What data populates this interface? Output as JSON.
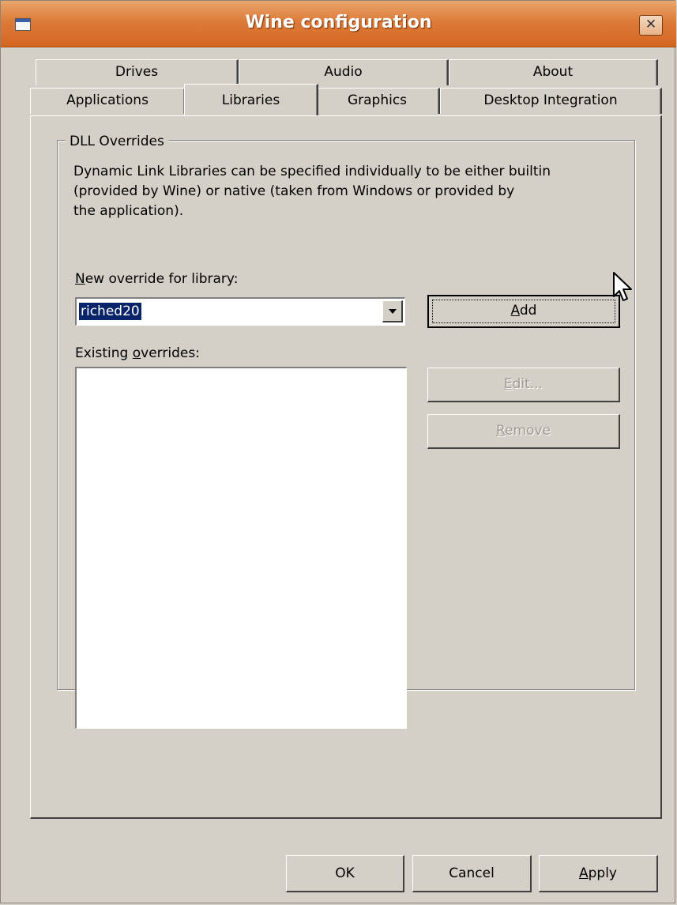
{
  "window": {
    "title": "Wine configuration",
    "close_symbol": "✕"
  },
  "tabs": {
    "row1": [
      "Drives",
      "Audio",
      "About"
    ],
    "row2": [
      "Applications",
      "Libraries",
      "Graphics",
      "Desktop Integration"
    ],
    "selected": "Libraries"
  },
  "dll_overrides": {
    "group_label": "DLL Overrides",
    "description_lines": [
      "Dynamic Link Libraries can be specified individually to be either builtin",
      "(provided by Wine) or native (taken from Windows or provided by",
      "the application)."
    ],
    "new_override_label_prefix": "",
    "new_override_label_access": "N",
    "new_override_label_rest": "ew override for library:",
    "new_override_value": "riched20",
    "existing_label_prefix": "Existing ",
    "existing_label_access": "o",
    "existing_label_rest": "verrides:",
    "existing_items": [],
    "add_button": {
      "access": "A",
      "rest": "dd"
    },
    "edit_button": {
      "access": "E",
      "rest": "dit..."
    },
    "remove_button": {
      "access": "R",
      "rest": "emove"
    }
  },
  "footer": {
    "ok_label": "OK",
    "cancel_label": "Cancel",
    "apply_access": "A",
    "apply_rest": "pply"
  },
  "colors": {
    "titlebar": "#dd7b3a",
    "face": "#d4d0c8",
    "selection": "#0a246a"
  },
  "icons": [
    "window-icon",
    "close-icon",
    "dropdown-arrow-icon",
    "mouse-cursor-icon"
  ]
}
